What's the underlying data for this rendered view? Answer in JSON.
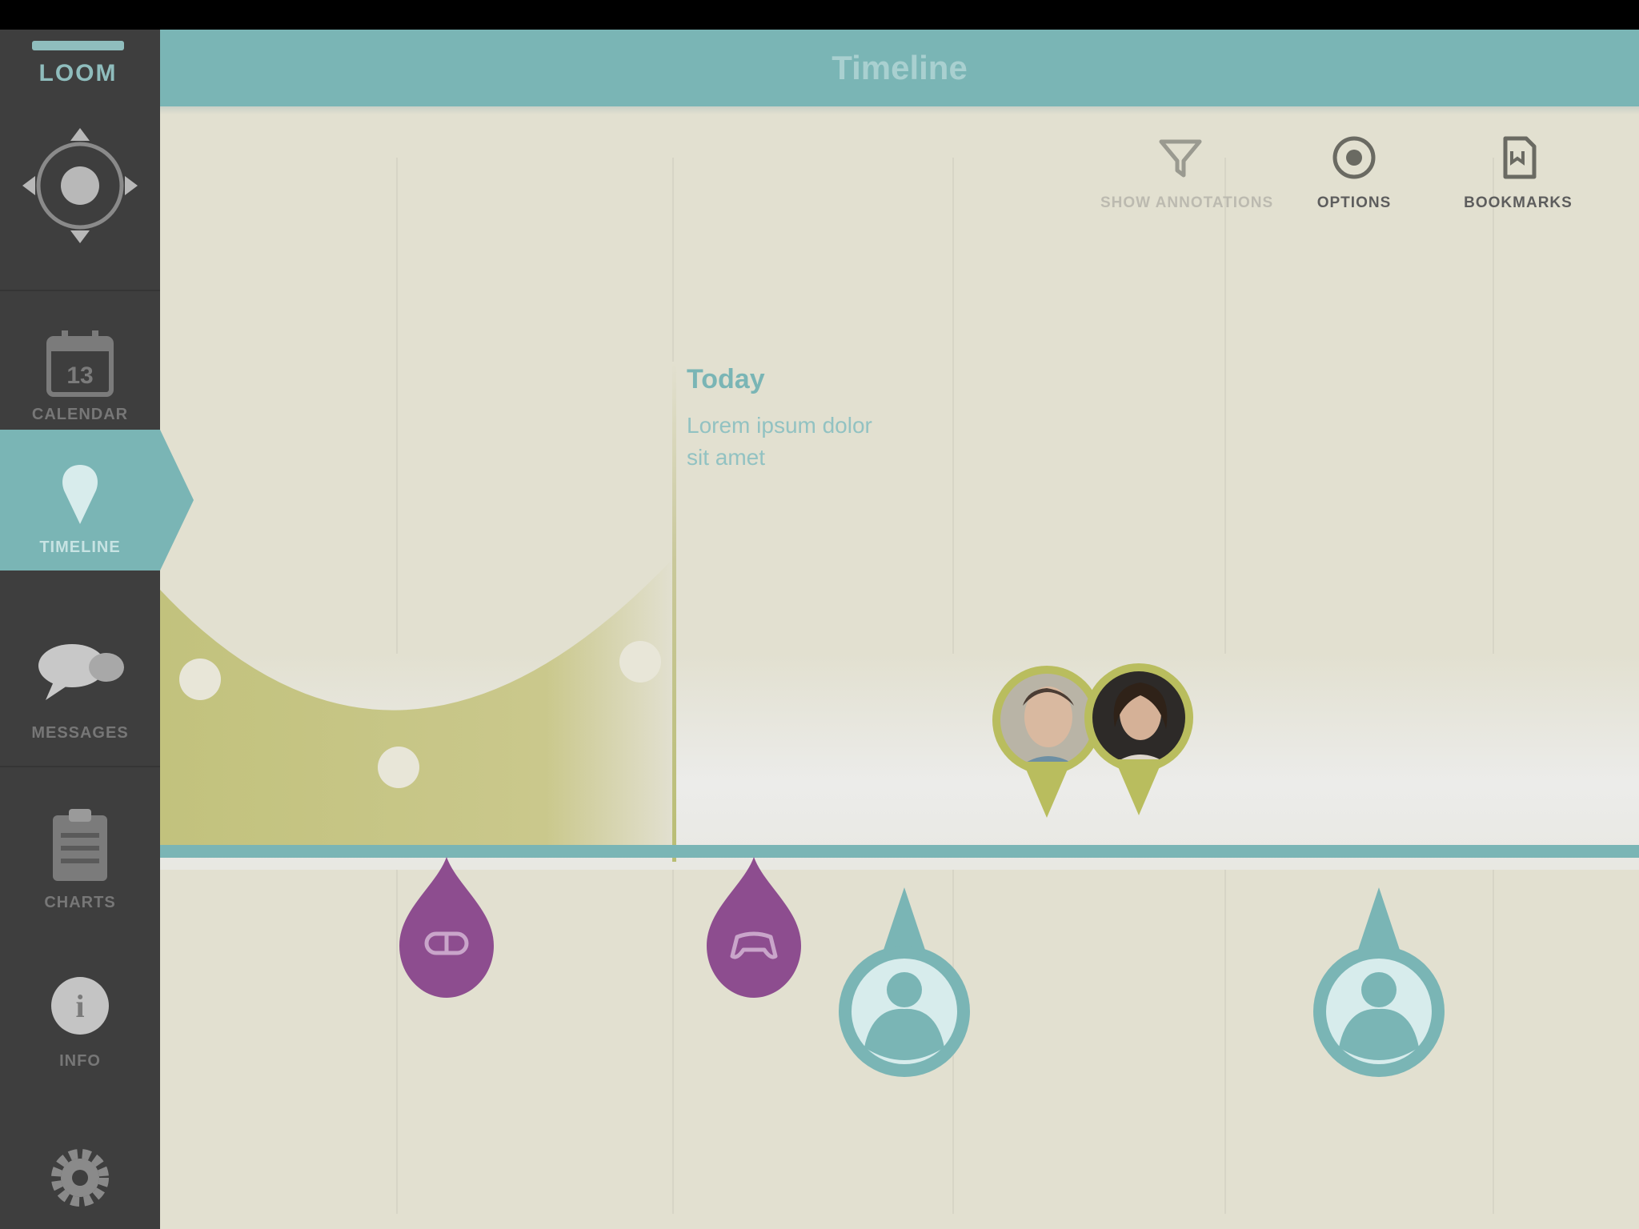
{
  "app": {
    "logo_text": "LOOM",
    "header_title": "Timeline"
  },
  "sidebar": {
    "items": [
      {
        "id": "navigate",
        "label": "",
        "icon": "dpad-icon"
      },
      {
        "id": "calendar",
        "label": "CALENDAR",
        "icon": "calendar-icon"
      },
      {
        "id": "timeline",
        "label": "TIMELINE",
        "icon": "pin-icon",
        "active": true
      },
      {
        "id": "messages",
        "label": "MESSAGES",
        "icon": "chat-bubble-icon"
      },
      {
        "id": "charts",
        "label": "CHARTS",
        "icon": "clipboard-icon"
      },
      {
        "id": "info",
        "label": "INFO",
        "icon": "info-icon"
      },
      {
        "id": "settings",
        "label": "",
        "icon": "gear-icon"
      }
    ]
  },
  "toolbar": {
    "items": [
      {
        "id": "filter",
        "label": "SHOW ANNOTATIONS",
        "icon": "filter-icon",
        "enabled": false
      },
      {
        "id": "options",
        "label": "OPTIONS",
        "icon": "options-icon",
        "enabled": true
      },
      {
        "id": "bookmarks",
        "label": "BOOKMARKS",
        "icon": "bookmark-icon",
        "enabled": true
      }
    ]
  },
  "event": {
    "title": "Today",
    "description_line1": "Lorem ipsum dolor",
    "description_line2": "sit amet"
  },
  "colors": {
    "teal": "#7ab5b5",
    "olive": "#b9bd5e",
    "purple": "#8d4d8f",
    "sidebar_bg": "#3e3e3e",
    "canvas_bg": "#e2e0d0"
  }
}
